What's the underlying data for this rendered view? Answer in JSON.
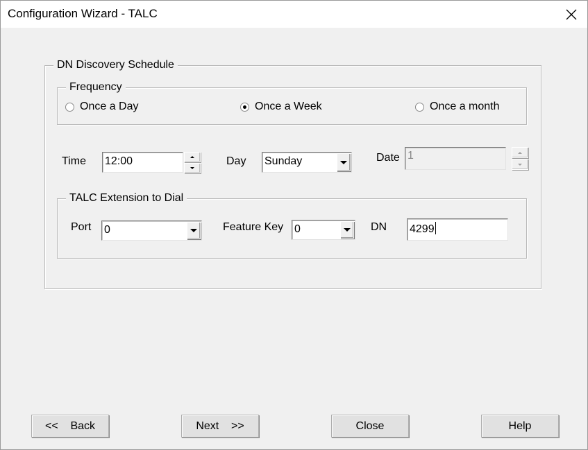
{
  "window": {
    "title": "Configuration Wizard - TALC",
    "close_icon": "close-x-icon"
  },
  "schedule": {
    "group_label": "DN Discovery Schedule",
    "frequency": {
      "group_label": "Frequency",
      "options": [
        {
          "label": "Once a Day",
          "selected": false
        },
        {
          "label": "Once a Week",
          "selected": true
        },
        {
          "label": "Once a month",
          "selected": false
        }
      ]
    },
    "time": {
      "label": "Time",
      "value": "12:00"
    },
    "day": {
      "label": "Day",
      "value": "Sunday"
    },
    "date": {
      "label": "Date",
      "value": "1",
      "enabled": false
    }
  },
  "extension": {
    "group_label": "TALC Extension to Dial",
    "port": {
      "label": "Port",
      "value": "0"
    },
    "feature_key": {
      "label": "Feature Key",
      "value": "0"
    },
    "dn": {
      "label": "DN",
      "value": "4299"
    }
  },
  "buttons": {
    "back": "<<    Back",
    "next": "Next    >>",
    "close": "Close",
    "help": "Help"
  }
}
